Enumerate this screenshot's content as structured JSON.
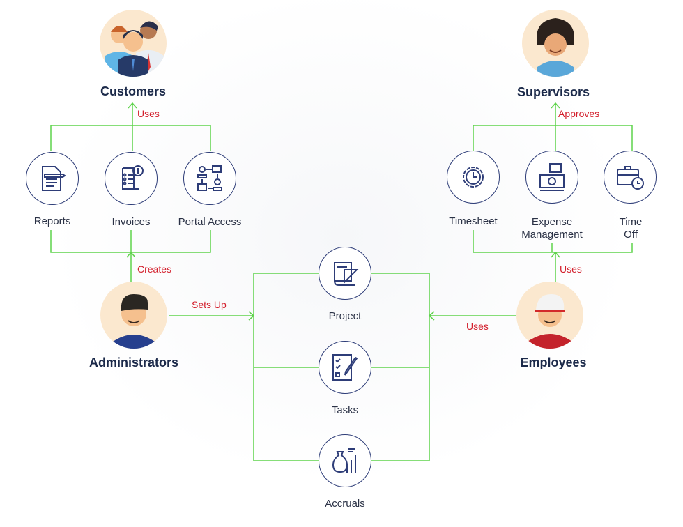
{
  "colors": {
    "connector": "#5fd34c",
    "relation_text": "#d31f2c",
    "node_border": "#2e3d78",
    "role_text": "#1c2a4a",
    "avatar_bg": "#fbe8cf"
  },
  "roles": {
    "customers": "Customers",
    "supervisors": "Supervisors",
    "administrators": "Administrators",
    "employees": "Employees"
  },
  "relations": {
    "customers_uses": "Uses",
    "supervisors_approves": "Approves",
    "admin_creates": "Creates",
    "admin_sets_up": "Sets Up",
    "employees_uses_center": "Uses",
    "employees_uses_top": "Uses"
  },
  "customer_features": [
    {
      "label": "Reports",
      "icon": "document-pen-icon"
    },
    {
      "label": "Invoices",
      "icon": "invoice-dollar-icon"
    },
    {
      "label": "Portal Access",
      "icon": "network-users-icon"
    }
  ],
  "employee_features": [
    {
      "label": "Timesheet",
      "icon": "gear-clock-icon"
    },
    {
      "label": "Expense Management",
      "icon": "money-icon"
    },
    {
      "label": "Time Off",
      "icon": "briefcase-clock-icon"
    }
  ],
  "central_features": [
    {
      "label": "Project",
      "icon": "blueprint-icon"
    },
    {
      "label": "Tasks",
      "icon": "checklist-pencil-icon"
    },
    {
      "label": "Accruals",
      "icon": "money-bag-chart-icon"
    }
  ]
}
